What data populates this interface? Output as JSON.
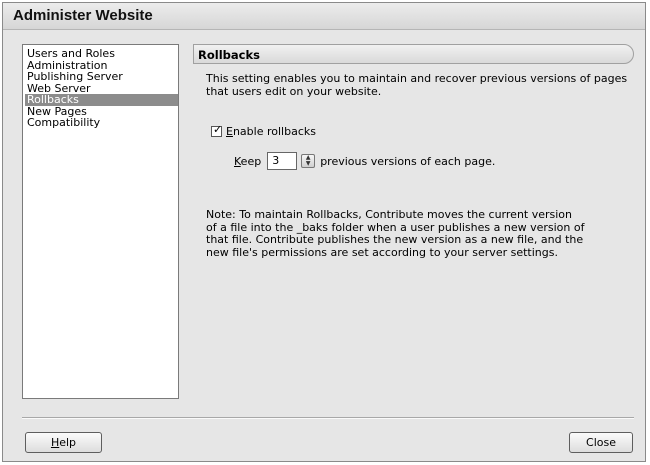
{
  "window": {
    "title": "Administer Website"
  },
  "sidebar": {
    "items": [
      {
        "label": "Users and Roles",
        "selected": false
      },
      {
        "label": "Administration",
        "selected": false
      },
      {
        "label": "Publishing Server",
        "selected": false
      },
      {
        "label": "Web Server",
        "selected": false
      },
      {
        "label": "Rollbacks",
        "selected": true
      },
      {
        "label": "New Pages",
        "selected": false
      },
      {
        "label": "Compatibility",
        "selected": false
      }
    ]
  },
  "main": {
    "header": "Rollbacks",
    "description": "This setting enables you to maintain and recover previous versions of pages that users edit on your website.",
    "enable_checkbox": {
      "label_prefix": "E",
      "label_rest": "nable rollbacks",
      "checked": true,
      "check_glyph": "✓"
    },
    "keep": {
      "label_prefix": "K",
      "label_rest": "eep",
      "value": "3",
      "suffix": "previous versions of each page."
    },
    "note": "Note: To maintain Rollbacks, Contribute moves the current version of a file into the _baks folder when a user publishes a new version of that file. Contribute publishes the new version as a new file, and the new file's permissions are set according to your server settings."
  },
  "footer": {
    "help_prefix": "H",
    "help_rest": "elp",
    "close_label": "Close"
  }
}
